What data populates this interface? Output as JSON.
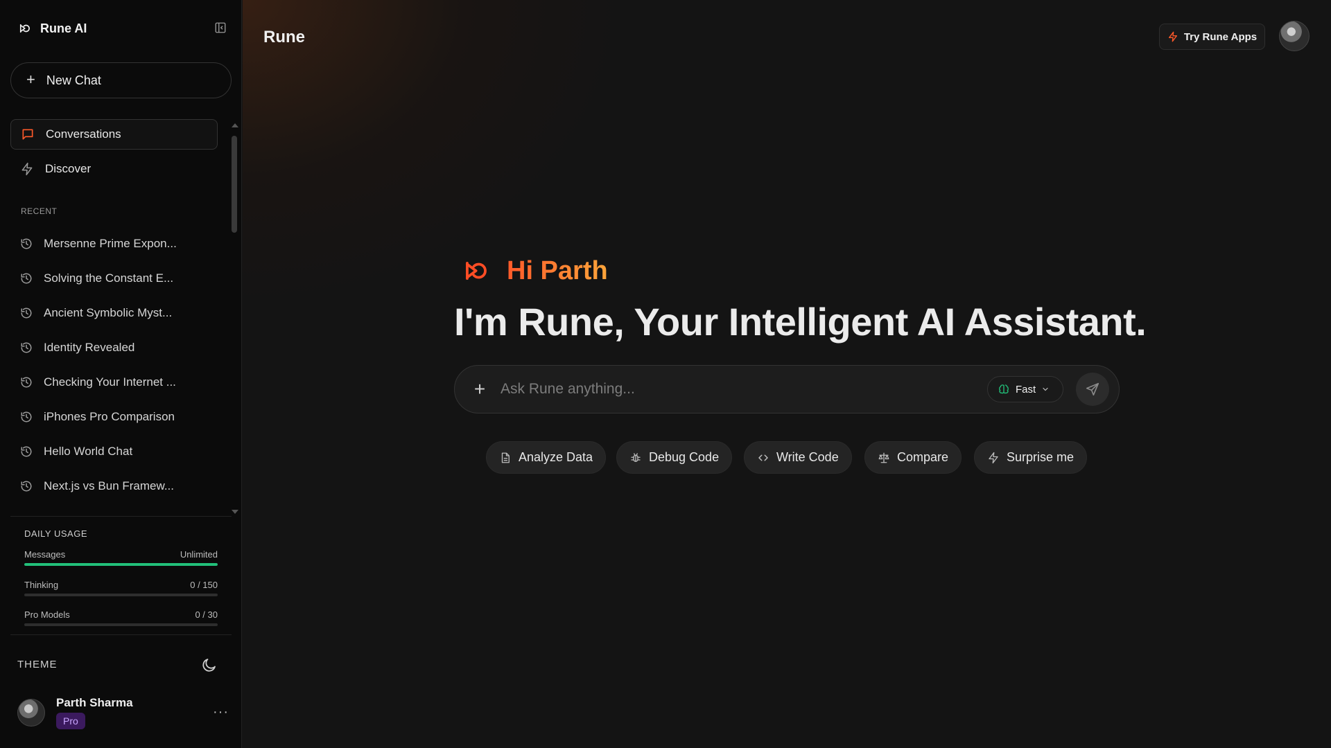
{
  "sidebar": {
    "brand": "Rune AI",
    "new_chat": "New Chat",
    "nav": [
      {
        "label": "Conversations",
        "icon": "message-square-icon"
      },
      {
        "label": "Discover",
        "icon": "bolt-icon"
      }
    ],
    "recent_label": "RECENT",
    "recent": [
      "Mersenne Prime Expon...",
      "Solving the Constant E...",
      "Ancient Symbolic Myst...",
      "Identity Revealed",
      "Checking Your Internet ...",
      "iPhones Pro Comparison",
      "Hello World Chat",
      "Next.js vs Bun Framew..."
    ],
    "usage": {
      "title": "DAILY USAGE",
      "rows": [
        {
          "name": "Messages",
          "value": "Unlimited",
          "fill": 1.0
        },
        {
          "name": "Thinking",
          "value": "0 / 150",
          "fill": 0.0
        },
        {
          "name": "Pro Models",
          "value": "0 / 30",
          "fill": 0.0
        }
      ]
    },
    "theme_label": "THEME",
    "user": {
      "name": "Parth Sharma",
      "badge": "Pro",
      "menu": "···"
    }
  },
  "header": {
    "title": "Rune",
    "try_apps": "Try Rune Apps"
  },
  "hero": {
    "greeting": "Hi Parth",
    "headline": "I'm Rune, Your Intelligent AI Assistant."
  },
  "composer": {
    "placeholder": "Ask Rune anything...",
    "speed": "Fast"
  },
  "suggestions": [
    {
      "label": "Analyze Data",
      "icon": "document-icon"
    },
    {
      "label": "Debug Code",
      "icon": "bug-icon"
    },
    {
      "label": "Write Code",
      "icon": "code-icon"
    },
    {
      "label": "Compare",
      "icon": "scale-icon"
    },
    {
      "label": "Surprise me",
      "icon": "bolt-icon"
    }
  ],
  "colors": {
    "accent_orange": "#ff5a2a",
    "accent_green": "#22c07a",
    "pro_badge": "#3b1a5e"
  }
}
